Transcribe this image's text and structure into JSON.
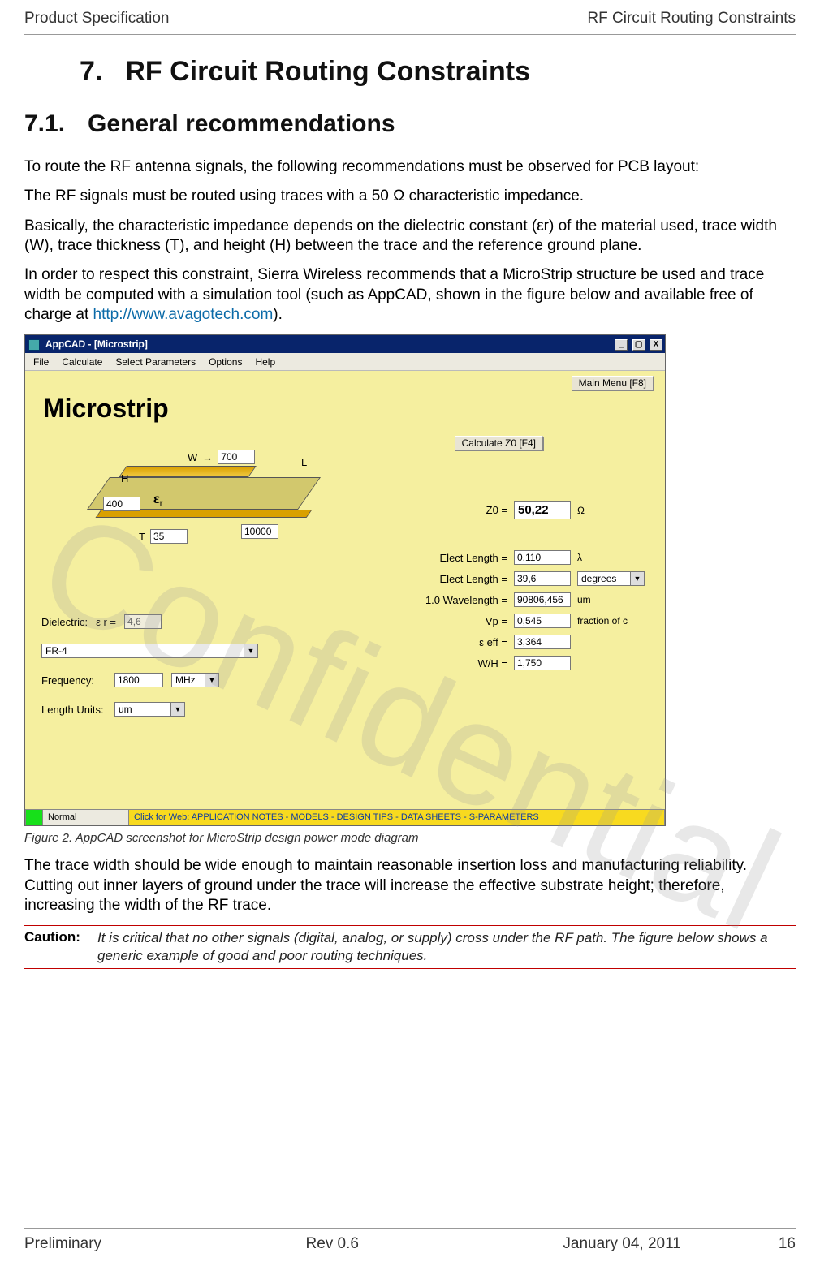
{
  "header": {
    "left": "Product Specification",
    "right": "RF Circuit Routing Constraints"
  },
  "section": {
    "number": "7.",
    "title": "RF Circuit Routing Constraints"
  },
  "subsection": {
    "number": "7.1.",
    "title": "General recommendations"
  },
  "para1": "To route the RF antenna signals, the following recommendations must be observed for PCB layout:",
  "para2a": "The RF signals must be routed using traces with a 50 ",
  "para2b": " characteristic impedance.",
  "ohm": "Ω",
  "para3": "Basically, the characteristic impedance depends on the dielectric constant (εr) of the material used, trace width (W), trace thickness (T), and height (H) between the trace and the reference ground plane.",
  "para4a": "In order to respect this constraint, Sierra Wireless recommends that a MicroStrip structure be used and trace width be computed with a simulation tool (such as AppCAD, shown in the figure below and available free of charge at ",
  "link_url": "http://www.avagotech.com",
  "para4b": ").",
  "figure_caption": "Figure 2.  AppCAD screenshot for MicroStrip design power mode diagram",
  "para5": "The trace width should be wide enough to maintain reasonable insertion loss and manufacturing reliability.  Cutting out inner layers of ground under the trace will increase the effective substrate height; therefore, increasing the width of the RF trace.",
  "caution_label": "Caution:",
  "caution_text": "It is critical that no other signals (digital, analog, or supply) cross under the RF path.  The figure below shows a generic example of good and poor routing techniques.",
  "footer": {
    "left": "Preliminary",
    "rev": "Rev 0.6",
    "date": "January 04, 2011",
    "page": "16"
  },
  "watermark": "Confidential",
  "appcad": {
    "title": "AppCAD - [Microstrip]",
    "menus": [
      "File",
      "Calculate",
      "Select Parameters",
      "Options",
      "Help"
    ],
    "main_menu_btn": "Main Menu [F8]",
    "calc_btn": "Calculate Z0  [F4]",
    "heading": "Microstrip",
    "diagram": {
      "W_label": "W",
      "W_value": "700",
      "H_label": "H",
      "H_value": "400",
      "T_label": "T",
      "T_value": "35",
      "L_label": "L",
      "L_value": "10000",
      "er_label": "ε",
      "er_sub": "r"
    },
    "left_panel": {
      "dielectric_label": "Dielectric:",
      "er_label": "ε r =",
      "er_value": "4,6",
      "dielectric_combo": "FR-4",
      "freq_label": "Frequency:",
      "freq_value": "1800",
      "freq_unit": "MHz",
      "length_units_label": "Length Units:",
      "length_units_value": "um"
    },
    "right_panel": {
      "z0_label": "Z0 =",
      "z0_value": "50,22",
      "z0_unit": "Ω",
      "el1_label": "Elect Length =",
      "el1_value": "0,110",
      "el1_unit": "λ",
      "el2_label": "Elect Length =",
      "el2_value": "39,6",
      "el2_unit": "degrees",
      "wl_label": "1.0 Wavelength =",
      "wl_value": "90806,456",
      "wl_unit": "um",
      "vp_label": "Vp =",
      "vp_value": "0,545",
      "vp_unit": "fraction of c",
      "eeff_label": "ε eff =",
      "eeff_value": "3,364",
      "wh_label": "W/H =",
      "wh_value": "1,750"
    },
    "status": {
      "normal": "Normal",
      "banner": "Click for Web: APPLICATION NOTES - MODELS - DESIGN TIPS - DATA SHEETS - S-PARAMETERS"
    }
  }
}
